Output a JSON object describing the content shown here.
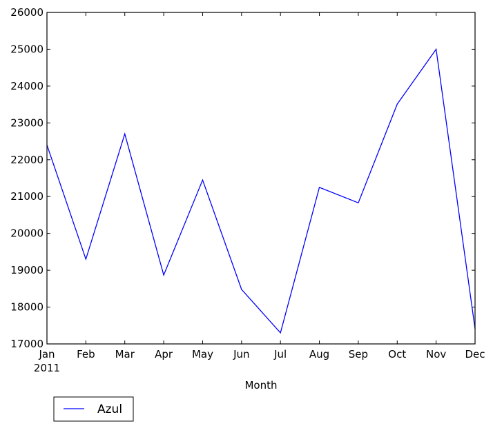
{
  "chart_data": {
    "type": "line",
    "title": "",
    "xlabel": "Month",
    "ylabel": "",
    "categories": [
      "Jan",
      "Feb",
      "Mar",
      "Apr",
      "May",
      "Jun",
      "Jul",
      "Aug",
      "Sep",
      "Oct",
      "Nov",
      "Dec"
    ],
    "x_year_label": "2011",
    "ylim": [
      17000,
      26000
    ],
    "yticks": [
      17000,
      18000,
      19000,
      20000,
      21000,
      22000,
      23000,
      24000,
      25000,
      26000
    ],
    "ytick_labels": [
      "17000",
      "18000",
      "19000",
      "20000",
      "21000",
      "22000",
      "23000",
      "24000",
      "25000",
      "26000"
    ],
    "grid": false,
    "legend_position": "below-left",
    "series": [
      {
        "name": "Azul",
        "color": "#0000ff",
        "values": [
          22400,
          19300,
          22700,
          18870,
          21450,
          18480,
          17300,
          21250,
          20830,
          23510,
          25000,
          17410
        ]
      }
    ]
  }
}
